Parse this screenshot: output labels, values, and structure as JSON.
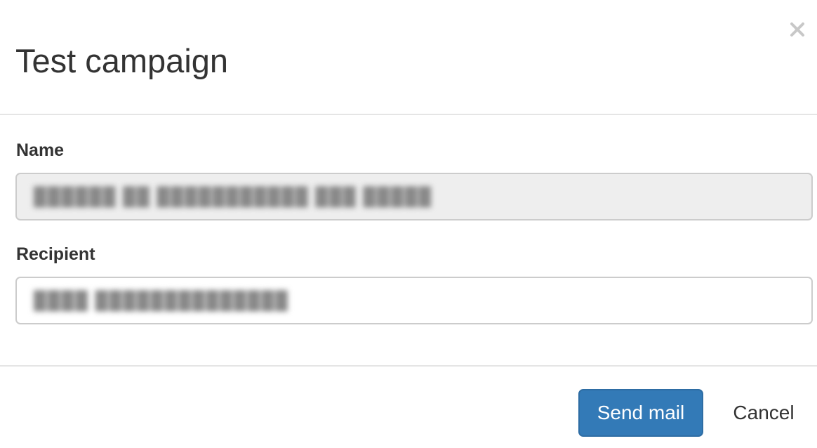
{
  "dialog": {
    "title": "Test campaign",
    "close_icon": "close-icon"
  },
  "form": {
    "name": {
      "label": "Name",
      "value": "██████ ██ ███████████ ███ █████",
      "readonly": true
    },
    "recipient": {
      "label": "Recipient",
      "value": "████ ██████████████"
    }
  },
  "footer": {
    "send_label": "Send mail",
    "cancel_label": "Cancel"
  },
  "colors": {
    "primary": "#337ab7",
    "readonly_bg": "#eeeeee",
    "divider": "#e5e5e5"
  }
}
